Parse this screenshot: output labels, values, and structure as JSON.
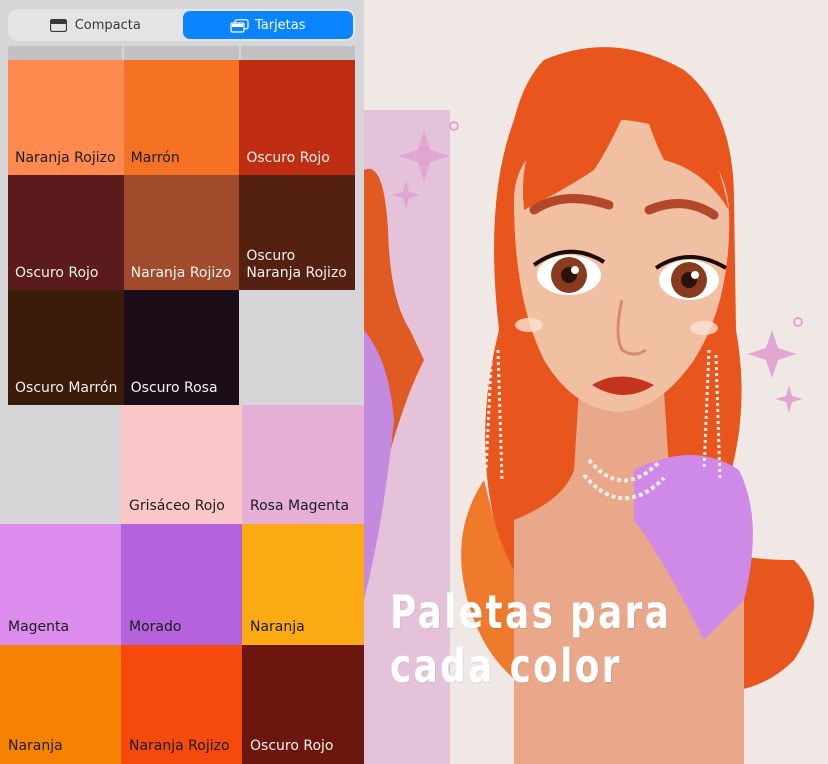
{
  "view_toggle": {
    "compact_label": "Compacta",
    "cards_label": "Tarjetas",
    "selected": "Tarjetas"
  },
  "palette_top": [
    {
      "name": "Naranja Rojizo",
      "color": "#fe8a50",
      "text": "dark"
    },
    {
      "name": "Marrón",
      "color": "#f57225",
      "text": "dark"
    },
    {
      "name": "Oscuro Rojo",
      "color": "#bf2e12",
      "text": "light"
    },
    {
      "name": "Oscuro Rojo",
      "color": "#5b1b1c",
      "text": "light"
    },
    {
      "name": "Naranja Rojizo",
      "color": "#a04b2c",
      "text": "light"
    },
    {
      "name": "Oscuro\nNaranja Rojizo",
      "color": "#542011",
      "text": "light"
    },
    {
      "name": "Oscuro Marrón",
      "color": "#3a1a08",
      "text": "light"
    },
    {
      "name": "Oscuro Rosa",
      "color": "#1c0e18",
      "text": "light"
    },
    {
      "name": "",
      "color": "#d6d6d8",
      "text": "dark"
    }
  ],
  "palette_bottom": [
    {
      "name": "",
      "color": "#d6d6d8",
      "text": "dark"
    },
    {
      "name": "Grisáceo Rojo",
      "color": "#fac6c7",
      "text": "dark"
    },
    {
      "name": "Rosa Magenta",
      "color": "#e6b0d6",
      "text": "dark"
    },
    {
      "name": "Magenta",
      "color": "#dc8ced",
      "text": "dark"
    },
    {
      "name": "Morado",
      "color": "#b563dd",
      "text": "dark"
    },
    {
      "name": "Naranja",
      "color": "#fcaa14",
      "text": "dark"
    },
    {
      "name": "Naranja",
      "color": "#f68201",
      "text": "dark"
    },
    {
      "name": "Naranja Rojizo",
      "color": "#f54a0c",
      "text": "dark"
    },
    {
      "name": "Oscuro Rojo",
      "color": "#6b160e",
      "text": "light"
    }
  ],
  "illustration": {
    "headline_line1": "Paletas para",
    "headline_line2": "cada color",
    "background": "#efe8e5",
    "hair": "#e8551d",
    "skin": "#f1c0a2",
    "dress": "#cf8ae8",
    "accent_pink": "#e2a6d2"
  }
}
